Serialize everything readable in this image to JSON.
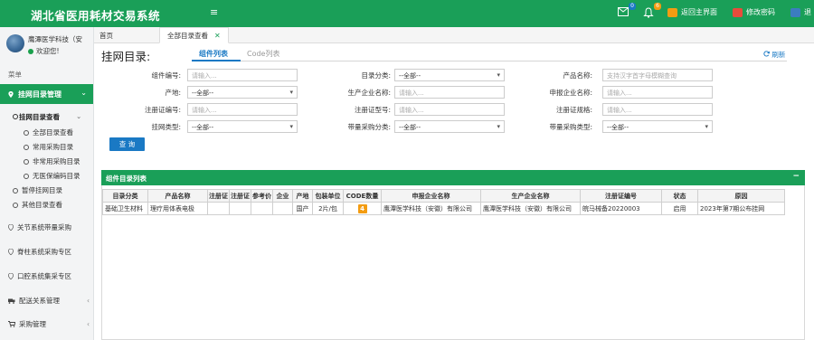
{
  "app": {
    "title": "湖北省医用耗材交易系统",
    "menu_toggle": "≡",
    "notif_mail_count": "0",
    "notif_bell_count": "6",
    "back_label": "返回主界面",
    "password_label": "修改密码",
    "exit_label": "退"
  },
  "user": {
    "name": "鹰潭医学科技（安",
    "status": "欢迎您!"
  },
  "sidebar": {
    "menu_header": "菜单",
    "active_section": "挂网目录管理",
    "subgroup_title": "挂网目录查看",
    "sub_items": [
      "全部目录查看",
      "常用采购目录",
      "非常用采购目录",
      "无医保编码目录"
    ],
    "extra_items": [
      "暂停挂网目录",
      "其他目录查看"
    ],
    "sections": [
      "关节系统带量采购",
      "脊柱系统采购专区",
      "口腔系统集采专区",
      "配送关系管理",
      "采购管理"
    ]
  },
  "tabs": {
    "home": "首页",
    "active": "全部目录查看",
    "close": "✕"
  },
  "page": {
    "title": "挂网目录:",
    "subtab_active": "组件列表",
    "subtab_inactive": "Code列表",
    "refresh": "刷新"
  },
  "form": {
    "component_no_label": "组件编号:",
    "component_no_placeholder": "请输入...",
    "catalog_class_label": "目录分类:",
    "catalog_class_value": "--全部--",
    "product_name_label": "产品名称:",
    "product_name_placeholder": "支持汉字首字母模糊查询",
    "origin_label": "产地:",
    "origin_value": "--全部--",
    "manufacturer_label": "生产企业名称:",
    "manufacturer_placeholder": "请输入...",
    "applicant_label": "申报企业名称:",
    "applicant_placeholder": "请输入...",
    "reg_no_label": "注册证编号:",
    "reg_no_placeholder": "请输入...",
    "reg_model_label": "注册证型号:",
    "reg_model_placeholder": "请输入...",
    "reg_spec_label": "注册证规格:",
    "reg_spec_placeholder": "请输入...",
    "listing_type_label": "挂网类型:",
    "listing_type_value": "--全部--",
    "vbp_class_label": "带量采购分类:",
    "vbp_class_value": "--全部--",
    "vbp_type_label": "带量采购类型:",
    "vbp_type_value": "--全部--",
    "query_button": "查 询"
  },
  "results": {
    "panel_title": "组件目录列表",
    "collapse": "−",
    "columns": [
      "目录分类",
      "产品名称",
      "注册证",
      "注册证",
      "参考价",
      "企业",
      "产地",
      "包装单位",
      "CODE数量",
      "申报企业名称",
      "生产企业名称",
      "注册证编号",
      "状态",
      "原因"
    ],
    "rows": [
      {
        "catalog_class": "基础卫生材料",
        "product_name": "理疗用体表电极",
        "reg_cert_1": "",
        "reg_cert_2": "",
        "ref_price": "",
        "enterprise": "",
        "origin": "国产",
        "pack_unit": "2片/包",
        "code_count": "4",
        "applicant": "鹰潭医学科技（安徽）有限公司",
        "manufacturer": "鹰潭医学科技（安徽）有限公司",
        "reg_no": "皖马械备20220003",
        "status": "启用",
        "reason": "2023年第7期公布挂网"
      }
    ]
  },
  "colors": {
    "brand_green": "#1a9f58",
    "link_blue": "#1a79c4",
    "badge_orange": "#f39c12"
  },
  "icons": [
    "mail-icon",
    "bell-icon",
    "home-icon",
    "key-icon",
    "exit-icon",
    "refresh-icon",
    "location-pin-icon",
    "truck-icon",
    "cart-icon"
  ]
}
